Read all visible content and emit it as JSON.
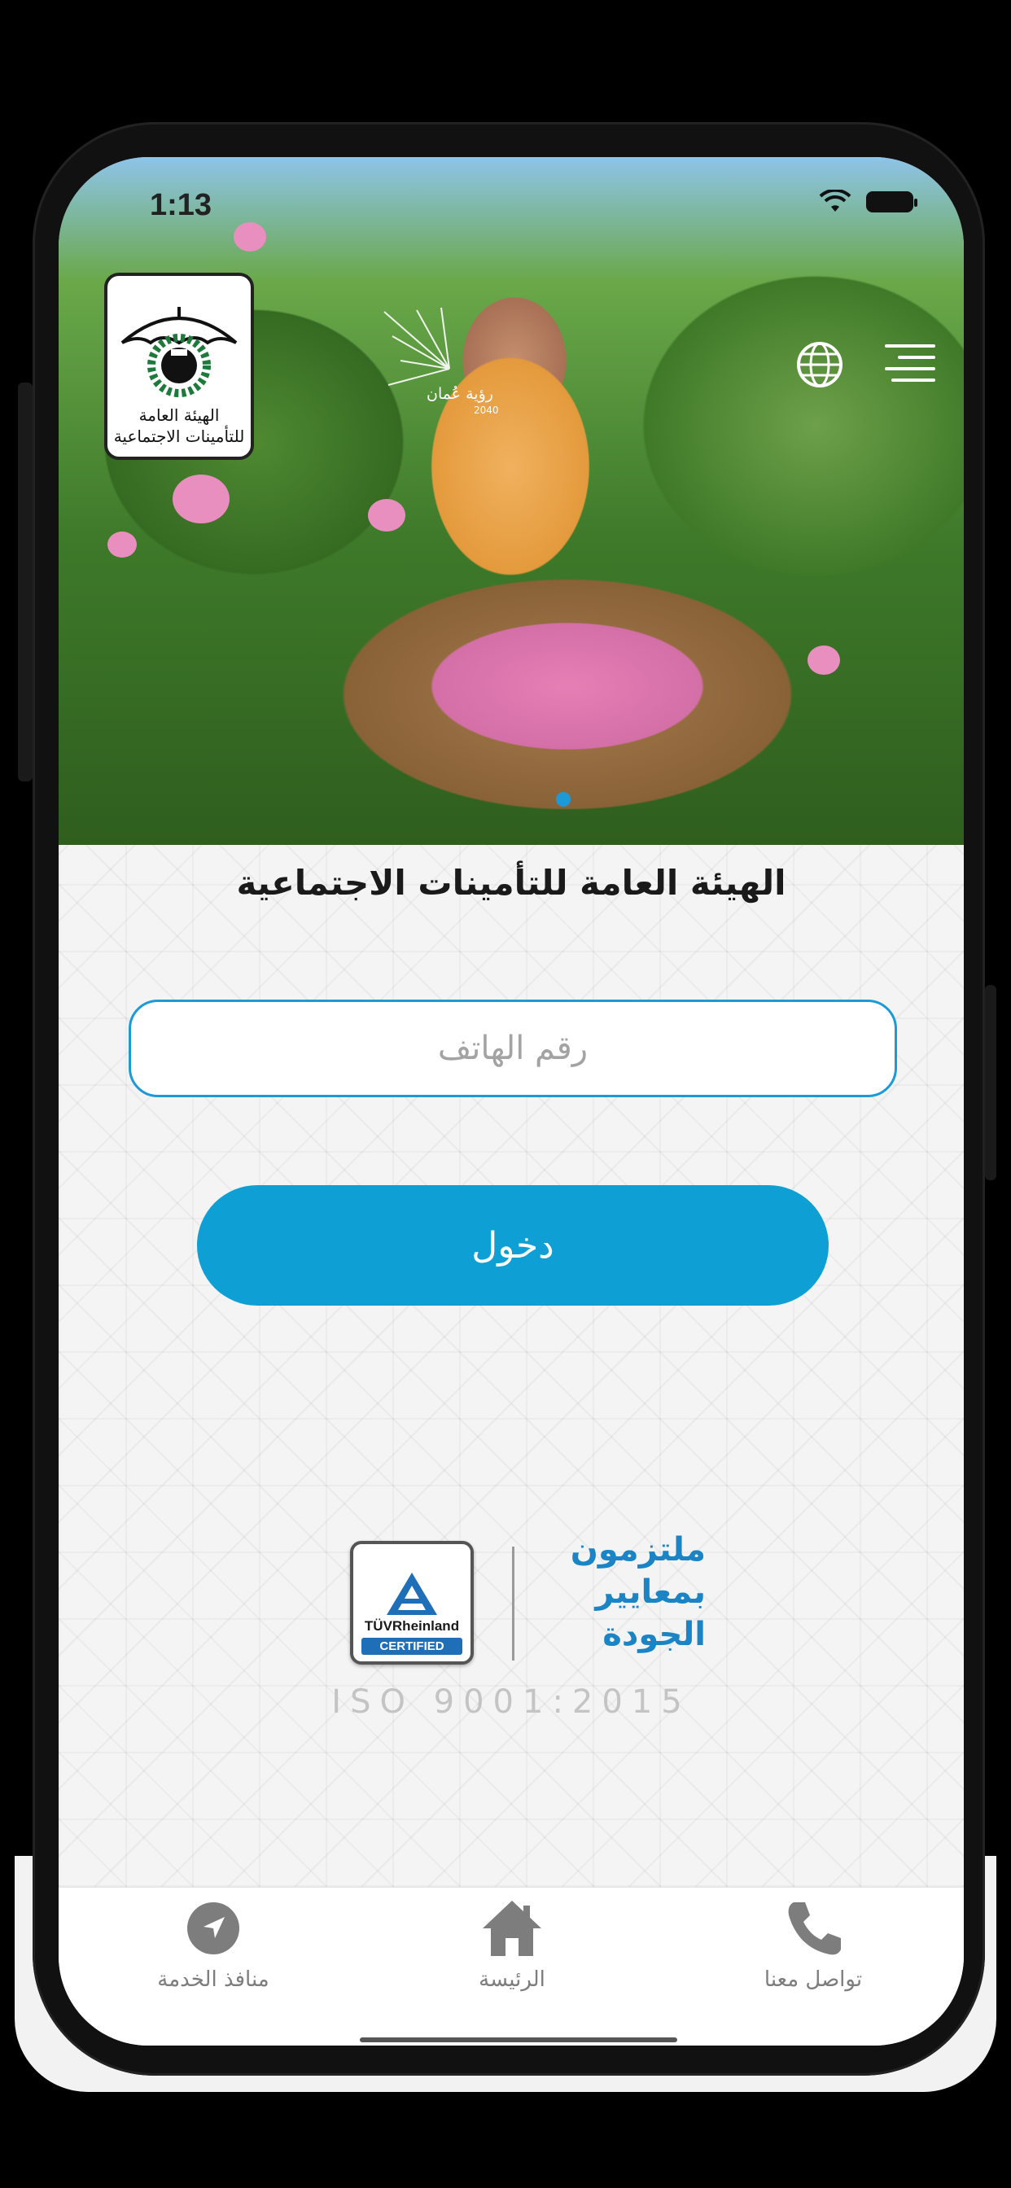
{
  "status_bar": {
    "time": "1:13",
    "icons": [
      "wifi-icon",
      "battery-icon"
    ]
  },
  "header": {
    "logo_text_line1": "الهيئة العامة",
    "logo_text_line2": "للتأمينات الاجتماعية",
    "vision_label": "رؤية عُمان",
    "vision_year": "2040",
    "icons": [
      "globe-icon",
      "menu-icon"
    ]
  },
  "hero": {
    "carousel_active_index": 1
  },
  "main": {
    "title": "الهيئة العامة للتأمينات الاجتماعية",
    "phone_placeholder": "رقم الهاتف",
    "phone_value": "",
    "login_label": "دخول"
  },
  "certification": {
    "brand": "TÜVRheinland",
    "badge": "CERTIFIED",
    "slogan_line1": "ملتزمون",
    "slogan_line2": "بمعايير",
    "slogan_line3": "الجودة",
    "standard": "ISO 9001:2015"
  },
  "tabbar": {
    "items": [
      {
        "label": "منافذ الخدمة",
        "icon": "navigation-arrow-icon"
      },
      {
        "label": "الرئيسة",
        "icon": "home-icon"
      },
      {
        "label": "تواصل معنا",
        "icon": "phone-icon"
      }
    ]
  },
  "colors": {
    "accent": "#0e9fd4",
    "input_border": "#1b9ad6",
    "quality_text": "#1b84c4",
    "tab_label": "#7d7d7d"
  }
}
